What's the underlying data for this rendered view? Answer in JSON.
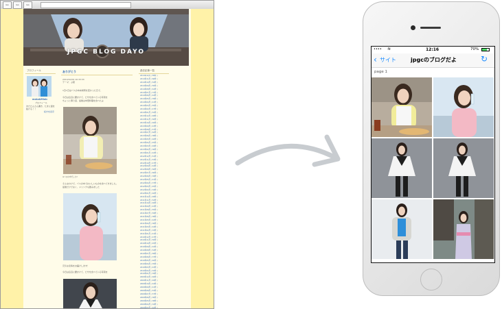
{
  "browser": {
    "toolbar": [
      "Go",
      "Go",
      "Go"
    ],
    "site_title": "JPGC BLOG DAYO",
    "sidebar_heading": "プロフィール",
    "profile_name": "moka&Minic",
    "profile_sub": "プロフィール",
    "profile_desc": "まだたんさん書き、たまに運を拡ける ！！",
    "profile_more": "続きを表示",
    "post_title": "ありがとう",
    "post_meta": [
      "2014/10/04 10:33:33",
      "テーマ：ぷ夏"
    ],
    "post_text_1": "1日1日はバスの中央場所を変わった日で、",
    "post_text_2": "今日は窓辺に腰かけて、ピザを食べている写真を",
    "post_text_3": "ちょっと寄り道、最後は中華料理を食べたよ",
    "photo_caption": "※バスの中でした!!",
    "post_text_4": "そんなわけで、バスの中でおいしいものを食べてきました。",
    "post_text_5": "最後だけでなく、ドリンクも飲みました",
    "post_text_6": "元気な表情をお届けします！",
    "archive_heading": "過去記事一覧",
    "archives": [
      "2014年12月 ( 58件 )",
      "2014年11月 ( 66件 )",
      "2014年10月 ( 54件 )",
      "2014年09月 ( 50件 )",
      "2014年08月 ( 61件 )",
      "2014年07月 ( 72件 )",
      "2014年06月 ( 44件 )",
      "2014年05月 ( 39件 )",
      "2014年04月 ( 41件 )",
      "2014年03月 ( 55件 )",
      "2014年02月 ( 47件 )",
      "2014年01月 ( 52件 )",
      "2013年12月 ( 48件 )",
      "2013年11月 ( 50件 )",
      "2013年10月 ( 46件 )",
      "2013年09月 ( 43件 )",
      "2013年08月 ( 57件 )",
      "2013年07月 ( 62件 )",
      "2013年06月 ( 38件 )",
      "2013年05月 ( 40件 )",
      "2013年04月 ( 45件 )",
      "2013年03月 ( 49件 )",
      "2013年02月 ( 36件 )",
      "2013年01月 ( 42件 )",
      "2012年12月 ( 51件 )",
      "2012年11月 ( 53件 )",
      "2012年10月 ( 47件 )",
      "2012年09月 ( 44件 )",
      "2012年08月 ( 56件 )",
      "2012年07月 ( 60件 )",
      "2012年06月 ( 39件 )",
      "2012年05月 ( 41件 )",
      "2012年04月 ( 37件 )",
      "2012年03月 ( 45件 )",
      "2012年02月 ( 34件 )",
      "2012年01月 ( 40件 )",
      "2011年12月 ( 48件 )",
      "2011年11月 ( 52件 )",
      "2011年10月 ( 46件 )",
      "2011年09月 ( 43件 )",
      "2011年08月 ( 55件 )",
      "2011年07月 ( 59件 )",
      "2011年06月 ( 38件 )",
      "2011年05月 ( 42件 )",
      "2011年04月 ( 36件 )",
      "2011年03月 ( 44件 )",
      "2011年02月 ( 33件 )",
      "2011年01月 ( 41件 )",
      "2010年12月 ( 47件 )",
      "2010年11月 ( 50件 )",
      "2010年10月 ( 45件 )",
      "2010年09月 ( 42件 )",
      "2010年08月 ( 54件 )",
      "2010年07月 ( 58件 )",
      "2010年06月 ( 37件 )",
      "2010年05月 ( 40件 )",
      "2010年04月 ( 35件 )",
      "2010年03月 ( 43件 )",
      "2010年02月 ( 32件 )",
      "2010年01月 ( 39件 )",
      "2009年12月 ( 46件 )",
      "2009年11月 ( 49件 )",
      "2009年10月 ( 44件 )",
      "2009年09月 ( 41件 )",
      "2009年08月 ( 53件 )",
      "2009年07月 ( 57件 )",
      "2009年06月 ( 36件 )",
      "2009年05月 ( 38件 )",
      "2009年04月 ( 34件 )",
      "2009年03月 ( 42件 )",
      "2009年02月 ( 31件 )",
      "2009年01月 ( 37件 )"
    ]
  },
  "phone": {
    "status_left": "•••• ",
    "status_time": "12:16",
    "status_battery": "70%",
    "back_label": "サイト",
    "nav_title": "jpgcのブログだよ",
    "page_label": "page 1"
  },
  "colors": {
    "ios_blue": "#1a8cff",
    "page_bg": "#fff2a8",
    "link_blue": "#3a70b8"
  }
}
